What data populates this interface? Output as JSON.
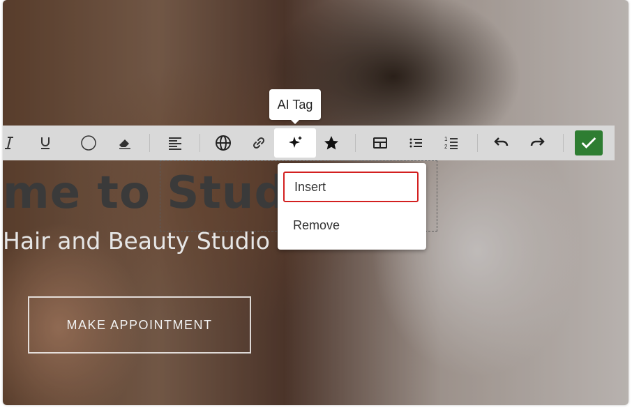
{
  "hero": {
    "title": "me to Studio",
    "subtitle": "Hair and Beauty Studio",
    "cta_label": "MAKE APPOINTMENT"
  },
  "tooltip": {
    "text": "AI Tag"
  },
  "dropdown": {
    "items": [
      {
        "label": "Insert",
        "highlighted": true
      },
      {
        "label": "Remove",
        "highlighted": false
      }
    ]
  },
  "toolbar": {
    "buttons": [
      "italic-icon",
      "underline-icon",
      "circle-icon",
      "eraser-icon",
      "align-left-icon",
      "globe-icon",
      "link-icon",
      "ai-sparkle-icon",
      "star-icon",
      "table-icon",
      "bullet-list-icon",
      "numbered-list-icon",
      "undo-icon",
      "redo-icon",
      "check-icon"
    ],
    "active": "ai-sparkle-icon",
    "confirm_color": "#2e7d32"
  },
  "colors": {
    "highlight_border": "#d32020",
    "toolbar_bg": "#d9d9d9"
  }
}
